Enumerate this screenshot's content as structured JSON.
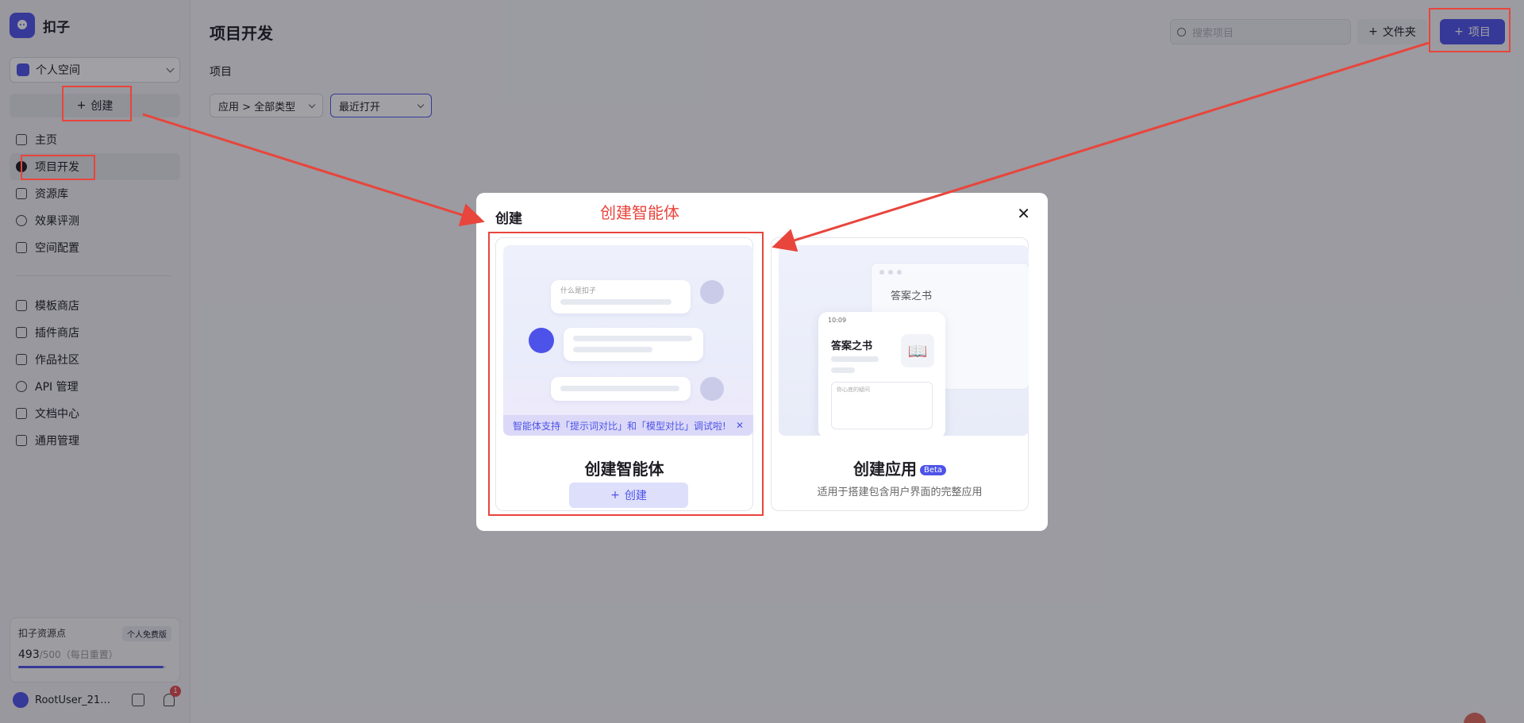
{
  "brand": {
    "name": "扣子"
  },
  "sidebar": {
    "space": "个人空间",
    "create_label": "创建",
    "nav_primary": [
      {
        "label": "主页",
        "icon": "home-icon"
      },
      {
        "label": "项目开发",
        "icon": "project-icon"
      },
      {
        "label": "资源库",
        "icon": "library-icon"
      },
      {
        "label": "效果评测",
        "icon": "evaluation-icon"
      },
      {
        "label": "空间配置",
        "icon": "settings-icon"
      }
    ],
    "nav_secondary": [
      {
        "label": "模板商店",
        "icon": "template-icon"
      },
      {
        "label": "插件商店",
        "icon": "plugin-icon"
      },
      {
        "label": "作品社区",
        "icon": "community-icon"
      },
      {
        "label": "API 管理",
        "icon": "api-icon"
      },
      {
        "label": "文档中心",
        "icon": "docs-icon"
      },
      {
        "label": "通用管理",
        "icon": "manage-icon"
      }
    ],
    "resource": {
      "title": "扣子资源点",
      "plan": "个人免费版",
      "value": "493",
      "total": "/500",
      "note": "（每日重置）",
      "used_fraction": 0.986
    },
    "user": {
      "name": "RootUser_211…",
      "notifications": "1"
    }
  },
  "header": {
    "title": "项目开发",
    "section": "项目",
    "filter_type": "应用 > 全部类型",
    "filter_sort": "最近打开",
    "search_placeholder": "搜索项目",
    "folder_label": "文件夹",
    "project_label": "项目"
  },
  "modal": {
    "title": "创建",
    "close": "✕",
    "agent_card": {
      "illus_question": "什么是扣子",
      "tip": "智能体支持「提示词对比」和「模型对比」调试啦!",
      "tip_close": "✕",
      "name": "创建智能体",
      "button": "创建"
    },
    "app_card": {
      "window_title": "答案之书",
      "phone_time": "10:09",
      "phone_title": "答案之书",
      "phone_input": "你心底的疑问",
      "name": "创建应用",
      "badge": "Beta",
      "desc": "适用于搭建包含用户界面的完整应用"
    }
  },
  "annotation": {
    "label": "创建智能体",
    "color": "#e8453c"
  },
  "colors": {
    "accent": "#4d53e8"
  }
}
